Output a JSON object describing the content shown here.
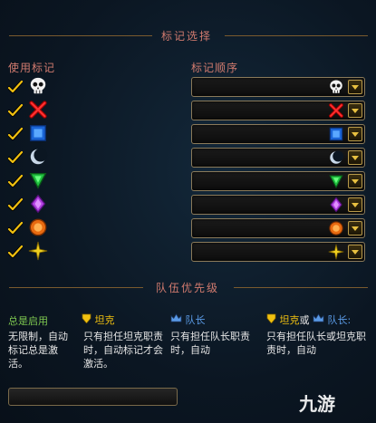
{
  "sections": {
    "marker_selection": "标记选择",
    "team_priority": "队伍优先级"
  },
  "columns": {
    "use_markers": "使用标记",
    "marker_order": "标记顺序"
  },
  "markers": [
    {
      "icon": "skull-icon",
      "checked": true
    },
    {
      "icon": "cross-icon",
      "checked": true
    },
    {
      "icon": "square-icon",
      "checked": true
    },
    {
      "icon": "moon-icon",
      "checked": true
    },
    {
      "icon": "triangle-icon",
      "checked": true
    },
    {
      "icon": "diamond-icon",
      "checked": true
    },
    {
      "icon": "circle-icon",
      "checked": true
    },
    {
      "icon": "star-icon",
      "checked": true
    }
  ],
  "priority": {
    "always": {
      "label": "总是启用",
      "desc": "无限制，自动标记总是激活。"
    },
    "tank": {
      "label": "坦克",
      "desc": "只有担任坦克职责时，自动标记才会激活。"
    },
    "leader": {
      "label": "队长",
      "desc": "只有担任队长职责时，自动"
    },
    "tank_or_leader": {
      "label_a": "坦克",
      "connector": "或",
      "label_b": "队长:",
      "desc": "只有担任队长或坦克职责时，自动"
    }
  },
  "watermark": "九游",
  "colors": {
    "accent_label": "#d07a6e",
    "gold": "#f0c010",
    "blue": "#5a9ae6",
    "green": "#7ec850"
  }
}
